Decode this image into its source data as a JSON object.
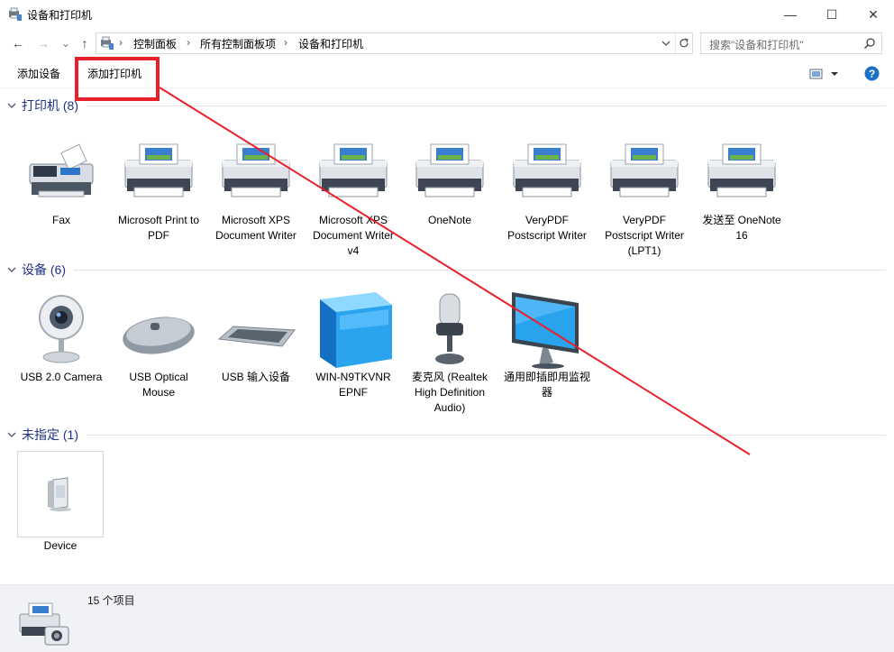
{
  "window": {
    "title": "设备和打印机",
    "minimize": "—",
    "maximize": "☐",
    "close": "✕"
  },
  "nav": {
    "back": "←",
    "forward": "→",
    "recent": "⌄",
    "up": "↑"
  },
  "address": {
    "breadcrumbs": [
      "控制面板",
      "所有控制面板项",
      "设备和打印机"
    ],
    "separator": "›"
  },
  "search": {
    "placeholder": "搜索\"设备和打印机\""
  },
  "toolbar": {
    "add_device": "添加设备",
    "add_printer": "添加打印机"
  },
  "groups": {
    "printers": {
      "title": "打印机 (8)",
      "items": [
        {
          "label": "Fax",
          "icon": "fax-icon"
        },
        {
          "label": "Microsoft Print to PDF",
          "icon": "printer-icon"
        },
        {
          "label": "Microsoft XPS Document Writer",
          "icon": "printer-icon"
        },
        {
          "label": "Microsoft XPS Document Writer v4",
          "icon": "printer-icon"
        },
        {
          "label": "OneNote",
          "icon": "printer-icon"
        },
        {
          "label": "VeryPDF Postscript Writer",
          "icon": "printer-icon"
        },
        {
          "label": "VeryPDF Postscript Writer (LPT1)",
          "icon": "printer-icon"
        },
        {
          "label": "发送至 OneNote 16",
          "icon": "printer-icon"
        }
      ]
    },
    "devices": {
      "title": "设备 (6)",
      "items": [
        {
          "label": "USB 2.0 Camera",
          "icon": "webcam-icon"
        },
        {
          "label": "USB Optical Mouse",
          "icon": "mouse-icon"
        },
        {
          "label": "USB 输入设备",
          "icon": "keyboard-icon"
        },
        {
          "label": "WIN-N9TKVNR EPNF",
          "icon": "computer-cube-icon"
        },
        {
          "label": "麦克风 (Realtek High Definition Audio)",
          "icon": "microphone-icon"
        },
        {
          "label": "通用即插即用监视器",
          "icon": "monitor-icon"
        }
      ]
    },
    "unspecified": {
      "title": "未指定 (1)",
      "items": [
        {
          "label": "Device",
          "icon": "generic-device-icon"
        }
      ]
    }
  },
  "status": {
    "count": "15 个项目"
  },
  "colors": {
    "group_header": "#1e3287",
    "annotation": "#e8202a",
    "status_bg": "#f0f2f5"
  }
}
